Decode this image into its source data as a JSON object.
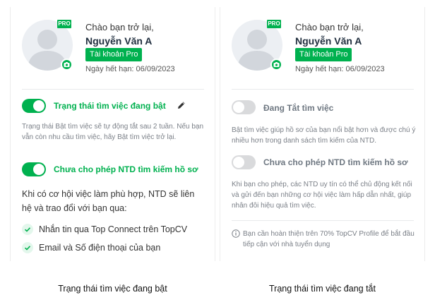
{
  "left_card": {
    "pro_badge": "PRO",
    "greeting": "Chào bạn trở lại,",
    "name": "Nguyễn Văn A",
    "account_badge": "Tài khoản Pro",
    "expiry": "Ngày hết hạn: 06/09/2023",
    "job_search_toggle": {
      "state": "on",
      "label": "Trạng thái tìm việc đang bật"
    },
    "job_search_note": "Trạng thái Bật tìm việc sẽ tự động tắt sau 2 tuần. Nếu bạn vẫn còn nhu cầu tìm việc, hãy Bật tìm việc trở lại.",
    "employer_toggle": {
      "state": "on",
      "label": "Chưa cho phép NTD tìm kiếm hồ sơ"
    },
    "contact_intro": "Khi có cơ hội việc làm phù hợp, NTD sẽ liên hệ và trao đổi với bạn qua:",
    "contact_items": [
      "Nhắn tin qua Top Connect trên TopCV",
      "Email và Số điện thoại của bạn"
    ]
  },
  "right_card": {
    "pro_badge": "PRO",
    "greeting": "Chào bạn trở lại,",
    "name": "Nguyễn Văn A",
    "account_badge": "Tài khoản Pro",
    "expiry": "Ngày hết hạn: 06/09/2023",
    "job_search_toggle": {
      "state": "off",
      "label": "Đang Tắt tìm việc"
    },
    "job_search_note": "Bật tìm việc giúp hồ sơ của bạn nổi bật hơn và được chú ý nhiều hơn trong danh sách tìm kiếm của NTD.",
    "employer_toggle": {
      "state": "off",
      "label": "Chưa cho phép NTD tìm kiếm hồ sơ"
    },
    "employer_note": "Khi bạn cho phép, các NTD uy tín có thể chủ động kết nối và gửi đến bạn những cơ hội việc làm hấp dẫn nhất, giúp nhân đôi hiệu quả tìm việc.",
    "profile_hint": "Bạn cần hoàn thiện trên 70% TopCV Profile để bắt đầu tiếp cận với nhà tuyển dụng"
  },
  "captions": {
    "left": "Trạng thái tìm việc đang bật",
    "right": "Trạng thái tìm việc đang tắt"
  },
  "colors": {
    "accent": "#00b14f",
    "toggle_off": "#d9dadc",
    "text": "#212f3f"
  }
}
